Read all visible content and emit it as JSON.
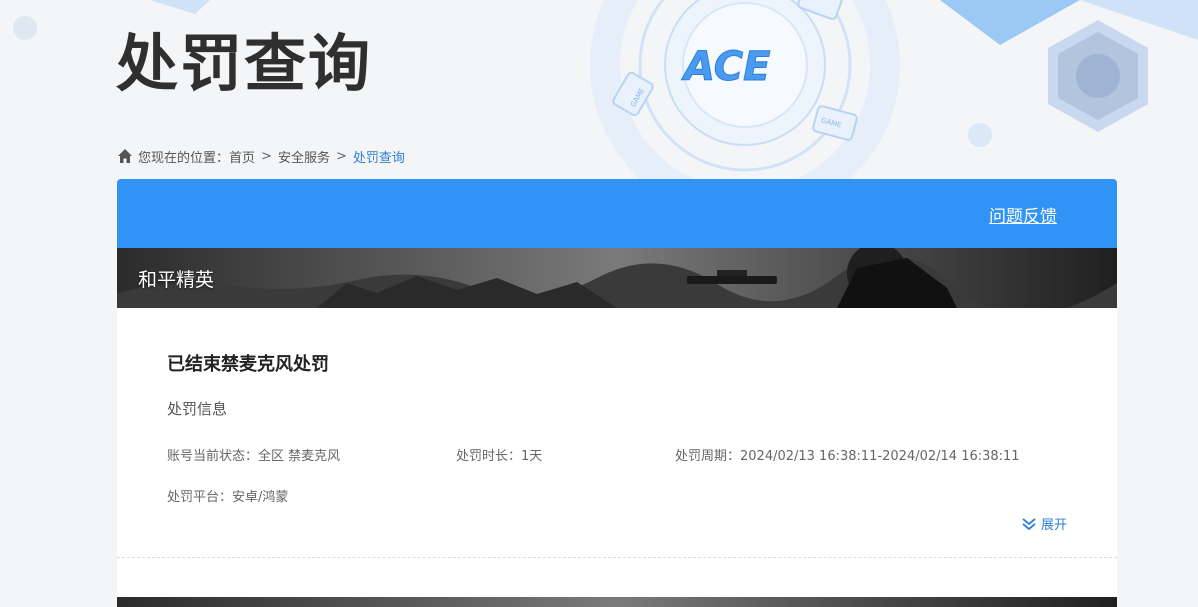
{
  "page": {
    "title": "处罚查询",
    "logo_text": "ACE",
    "deco_labels": [
      "GAME",
      "GAME"
    ]
  },
  "breadcrumb": {
    "prefix": "您现在的位置：",
    "items": [
      "首页",
      "安全服务"
    ],
    "current": "处罚查询",
    "separator": ">"
  },
  "header": {
    "feedback_label": "问题反馈"
  },
  "game": {
    "name": "和平精英"
  },
  "record": {
    "title": "已结束禁麦克风处罚",
    "section_label": "处罚信息",
    "status": "账号当前状态：全区 禁麦克风",
    "duration": "处罚时长：1天",
    "period": "处罚周期：2024/02/13 16:38:11-2024/02/14 16:38:11",
    "platform": "处罚平台：安卓/鸿蒙",
    "expand_label": "展开"
  },
  "colors": {
    "accent": "#3193f5",
    "link": "#2e7fd1",
    "title": "#2f2f2f"
  }
}
